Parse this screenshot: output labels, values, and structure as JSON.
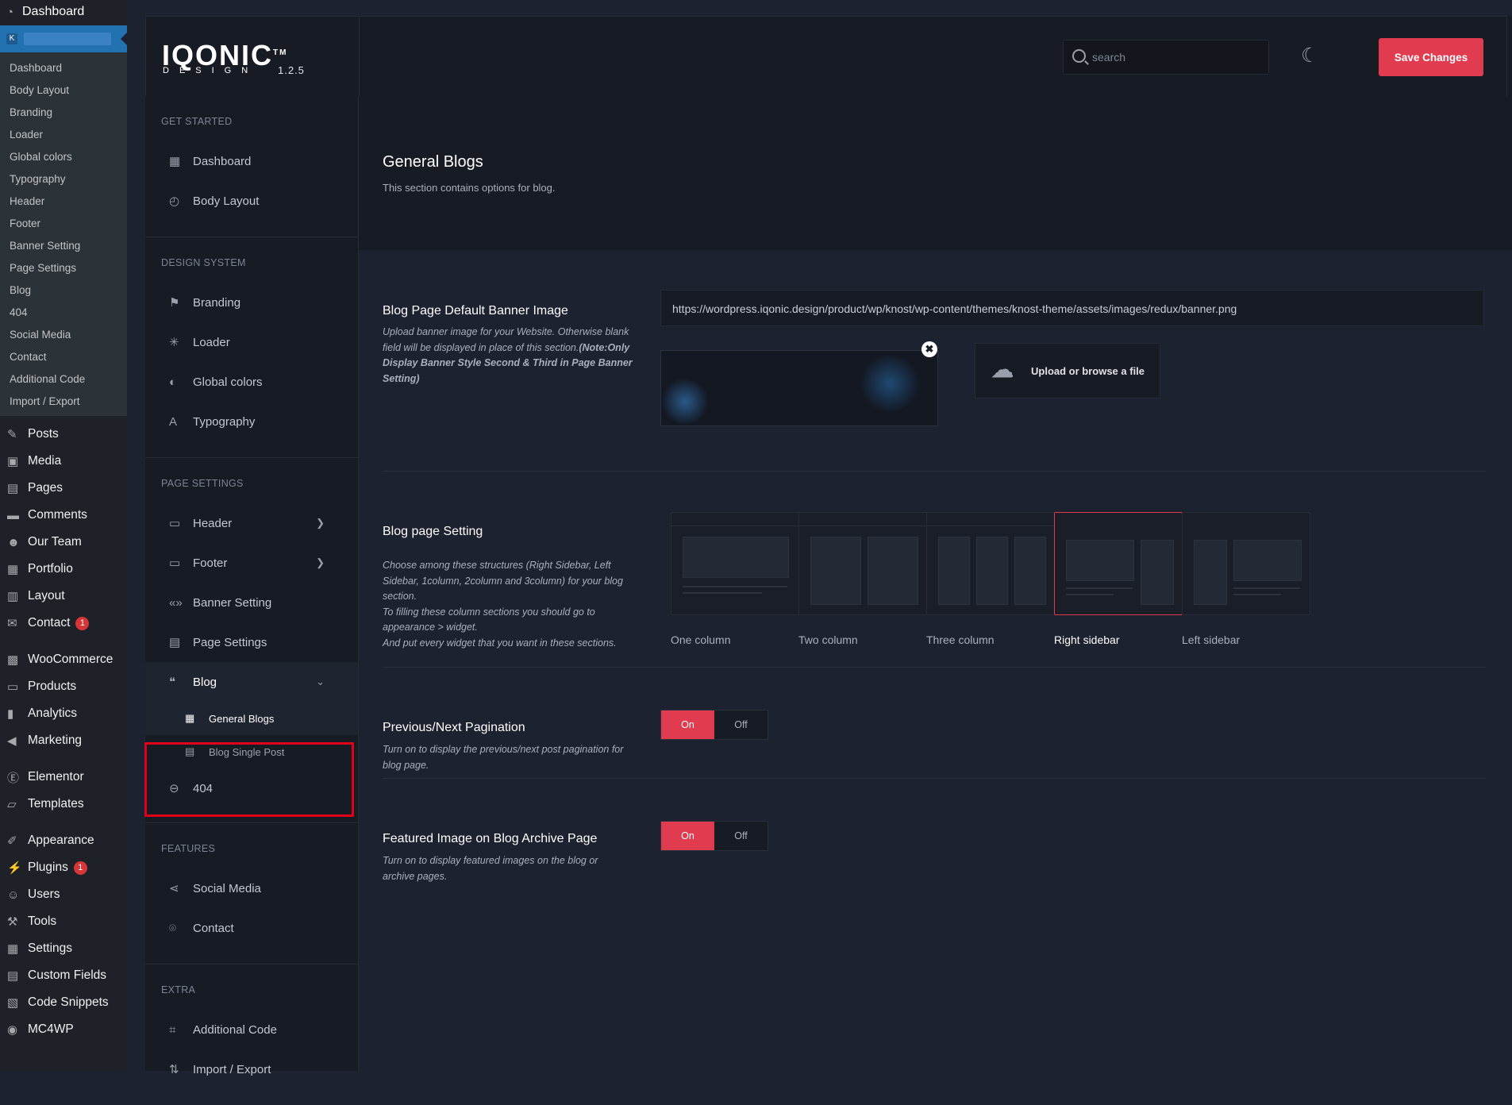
{
  "wp": {
    "top_label": "Dashboard",
    "active_initial": "K",
    "submenu": [
      "Dashboard",
      "Body Layout",
      "Branding",
      "Loader",
      "Global colors",
      "Typography",
      "Header",
      "Footer",
      "Banner Setting",
      "Page Settings",
      "Blog",
      "404",
      "Social Media",
      "Contact",
      "Additional Code",
      "Import / Export"
    ],
    "menu": [
      {
        "label": "Posts",
        "icon": "pin-icon"
      },
      {
        "label": "Media",
        "icon": "media-icon"
      },
      {
        "label": "Pages",
        "icon": "pages-icon"
      },
      {
        "label": "Comments",
        "icon": "comments-icon"
      },
      {
        "label": "Our Team",
        "icon": "team-icon"
      },
      {
        "label": "Portfolio",
        "icon": "portfolio-icon"
      },
      {
        "label": "Layout",
        "icon": "layout-icon"
      },
      {
        "label": "Contact",
        "icon": "mail-icon",
        "badge": "1"
      },
      {
        "label": "WooCommerce",
        "icon": "woo-icon"
      },
      {
        "label": "Products",
        "icon": "products-icon"
      },
      {
        "label": "Analytics",
        "icon": "analytics-icon"
      },
      {
        "label": "Marketing",
        "icon": "marketing-icon"
      },
      {
        "label": "Elementor",
        "icon": "elementor-icon"
      },
      {
        "label": "Templates",
        "icon": "folder-icon"
      },
      {
        "label": "Appearance",
        "icon": "brush-icon"
      },
      {
        "label": "Plugins",
        "icon": "plugin-icon",
        "badge": "1"
      },
      {
        "label": "Users",
        "icon": "user-icon"
      },
      {
        "label": "Tools",
        "icon": "wrench-icon"
      },
      {
        "label": "Settings",
        "icon": "settings-icon"
      },
      {
        "label": "Custom Fields",
        "icon": "fields-icon"
      },
      {
        "label": "Code Snippets",
        "icon": "code-icon"
      },
      {
        "label": "MC4WP",
        "icon": "mc4wp-icon"
      }
    ]
  },
  "header": {
    "logo_main": "IQONIC",
    "logo_tm": "TM",
    "logo_sub": "DESIGN",
    "version": "1.2.5",
    "search_placeholder": "search",
    "save_label": "Save Changes"
  },
  "nav": {
    "get_started": "GET STARTED",
    "dashboard": "Dashboard",
    "body_layout": "Body Layout",
    "design_system": "DESIGN SYSTEM",
    "branding": "Branding",
    "loader": "Loader",
    "global_colors": "Global colors",
    "typography": "Typography",
    "page_settings_heading": "PAGE SETTINGS",
    "header": "Header",
    "footer": "Footer",
    "banner_setting": "Banner Setting",
    "page_settings": "Page Settings",
    "blog": "Blog",
    "general_blogs": "General Blogs",
    "blog_single_post": "Blog Single Post",
    "n404": "404",
    "features": "FEATURES",
    "social_media": "Social Media",
    "contact": "Contact",
    "extra": "EXTRA",
    "additional_code": "Additional Code",
    "import_export": "Import / Export"
  },
  "main": {
    "title": "General Blogs",
    "subtitle": "This section contains options for blog.",
    "banner": {
      "title": "Blog Page Default Banner Image",
      "desc": "Upload banner image for your Website. Otherwise blank field will be displayed in place of this section.",
      "desc_note": "(Note:Only Display Banner Style Second & Third in Page Banner Setting)",
      "url": "https://wordpress.iqonic.design/product/wp/knost/wp-content/themes/knost-theme/assets/images/redux/banner.png",
      "upload_label": "Upload or browse a file"
    },
    "layout": {
      "title": "Blog page Setting",
      "desc": "Choose among these structures (Right Sidebar, Left Sidebar, 1column, 2column and 3column) for your blog section.",
      "desc2": "To filling these column sections you should go to appearance > widget.",
      "desc3": "And put every widget that you want in these sections.",
      "options": [
        "One column",
        "Two column",
        "Three column",
        "Right sidebar",
        "Left sidebar"
      ],
      "selected": "Right sidebar"
    },
    "pagination": {
      "title": "Previous/Next Pagination",
      "desc": "Turn on to display the previous/next post pagination for blog page.",
      "on": "On",
      "off": "Off"
    },
    "featured": {
      "title": "Featured Image on Blog Archive Page",
      "desc": "Turn on to display featured images on the blog or archive pages.",
      "on": "On",
      "off": "Off"
    }
  },
  "colors": {
    "accent": "#e03b4e",
    "wp_active": "#2271b1",
    "highlight": "#e0001a"
  }
}
